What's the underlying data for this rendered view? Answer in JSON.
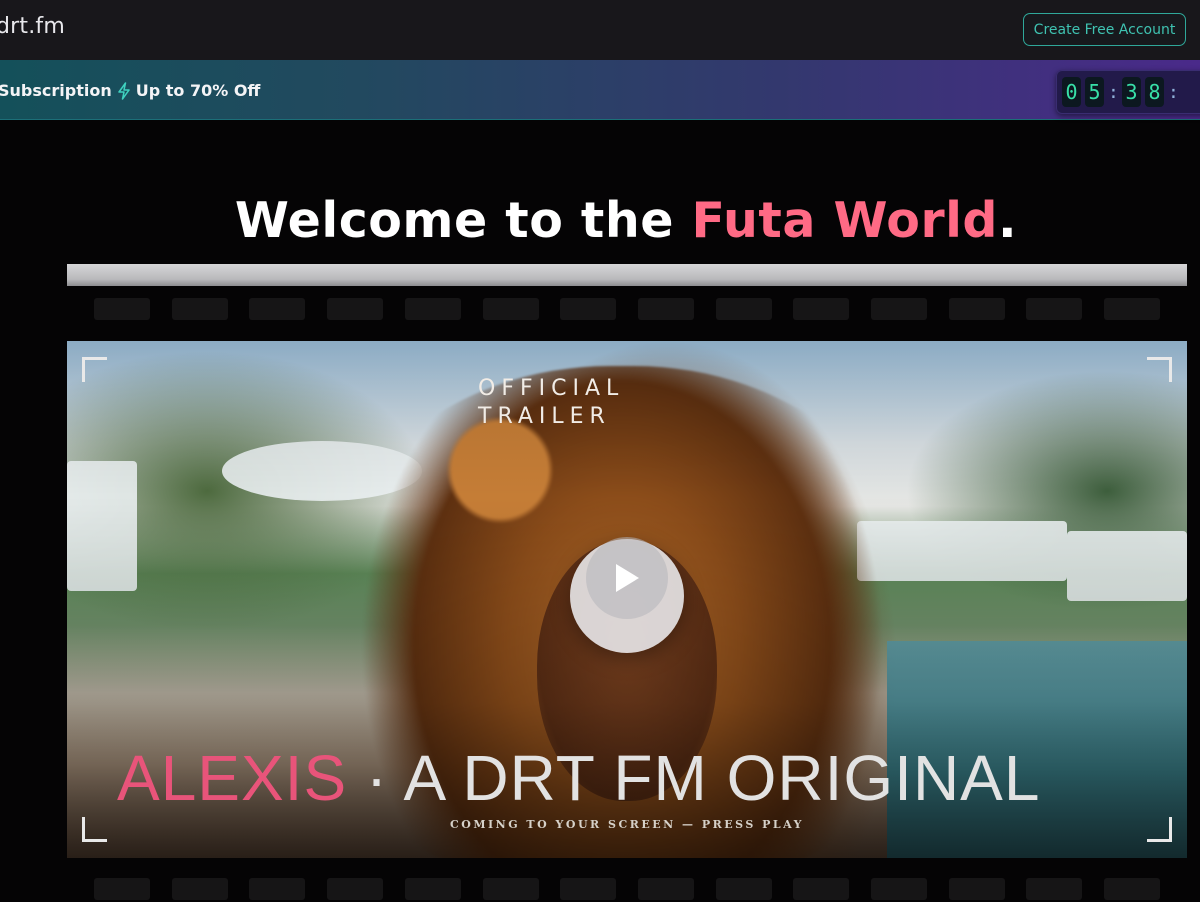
{
  "header": {
    "logo": "drt.fm",
    "create_account_label": "Create Free Account"
  },
  "promo": {
    "text_left": "Subscription",
    "text_right": "Up to 70% Off",
    "bolt_icon": "lightning-icon",
    "countdown": {
      "d1": "0",
      "d2": "5",
      "sep1": ":",
      "d3": "3",
      "d4": "8",
      "sep2": ":"
    }
  },
  "hero": {
    "headline_prefix": "Welcome to the ",
    "headline_accent": "Futa World",
    "headline_suffix": ".",
    "accent_color": "#ff6a85"
  },
  "video": {
    "overlay_line1": "OFFICIAL",
    "overlay_line2": "TRAILER",
    "title_name": "ALEXIS",
    "title_rest": " · A DRT FM ORIGINAL",
    "tagline": "COMING TO YOUR SCREEN — PRESS PLAY",
    "play_icon": "play-icon"
  }
}
